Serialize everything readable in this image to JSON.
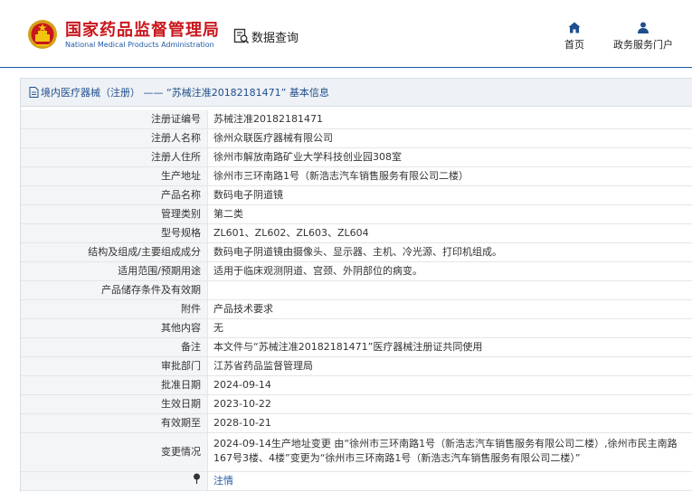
{
  "header": {
    "logo_cn": "国家药品监督管理局",
    "logo_en": "National Medical Products Administration",
    "query_label": "数据查询",
    "nav": [
      {
        "label": "首页",
        "icon": "home-icon"
      },
      {
        "label": "政务服务门户",
        "icon": "user-icon"
      }
    ],
    "accent_color": "#c8161d",
    "brand_color": "#1f5aa6"
  },
  "panel": {
    "title": "境内医疗器械（注册） —— “苏械注准20182181471” 基本信息"
  },
  "rows": [
    {
      "label": "注册证编号",
      "value": "苏械注准20182181471"
    },
    {
      "label": "注册人名称",
      "value": "徐州众联医疗器械有限公司"
    },
    {
      "label": "注册人住所",
      "value": "徐州市解放南路矿业大学科技创业园308室"
    },
    {
      "label": "生产地址",
      "value": "徐州市三环南路1号（新浩志汽车销售服务有限公司二楼）"
    },
    {
      "label": "产品名称",
      "value": "数码电子阴道镜"
    },
    {
      "label": "管理类别",
      "value": "第二类"
    },
    {
      "label": "型号规格",
      "value": "ZL601、ZL602、ZL603、ZL604"
    },
    {
      "label": "结构及组成/主要组成成分",
      "value": "数码电子阴道镜由摄像头、显示器、主机、冷光源、打印机组成。"
    },
    {
      "label": "适用范围/预期用途",
      "value": "适用于临床观测阴道、宫颈、外阴部位的病变。"
    },
    {
      "label": "产品储存条件及有效期",
      "value": ""
    },
    {
      "label": "附件",
      "value": "产品技术要求"
    },
    {
      "label": "其他内容",
      "value": "无"
    },
    {
      "label": "备注",
      "value": "本文件与“苏械注准20182181471”医疗器械注册证共同使用"
    },
    {
      "label": "审批部门",
      "value": "江苏省药品监督管理局"
    },
    {
      "label": "批准日期",
      "value": "2024-09-14"
    },
    {
      "label": "生效日期",
      "value": "2023-10-22"
    },
    {
      "label": "有效期至",
      "value": "2028-10-21"
    },
    {
      "label": "变更情况",
      "value": "2024-09-14生产地址变更 由“徐州市三环南路1号（新浩志汽车销售服务有限公司二楼）,徐州市民主南路167号3楼、4楼”变更为“徐州市三环南路1号（新浩志汽车销售服务有限公司二楼）”"
    }
  ],
  "note_row": {
    "value": "注情"
  }
}
